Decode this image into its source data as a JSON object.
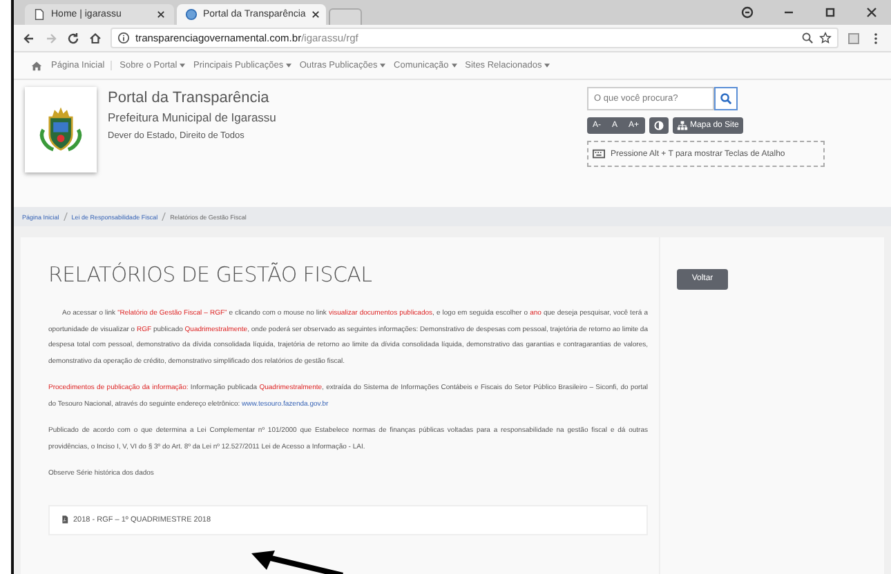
{
  "browser": {
    "tabs": [
      {
        "label": "Home | igarassu",
        "selected": false
      },
      {
        "label": "Portal da Transparência",
        "selected": true
      }
    ],
    "url": {
      "host": "transparenciagovernamental.com.br",
      "path": "/igarassu/rgf"
    }
  },
  "nav": {
    "home": "Página Inicial",
    "menus": [
      "Sobre o Portal",
      "Principais Publicações",
      "Outras Publicações",
      "Comunicação",
      "Sites Relacionados"
    ]
  },
  "header": {
    "title": "Portal da Transparência",
    "subtitle": "Prefeitura Municipal de Igarassu",
    "motto": "Dever do Estado, Direito de Todos",
    "search": {
      "placeholder": "O que você procura?"
    },
    "font_buttons": [
      "A-",
      "A",
      "A+"
    ],
    "sitemap": "Mapa do Site",
    "shortcut_hint": "Pressione Alt + T para mostrar Teclas de Atalho"
  },
  "breadcrumb": [
    {
      "label": "Página Inicial",
      "link": true
    },
    {
      "label": "Lei de Responsabilidade Fiscal",
      "link": true
    },
    {
      "label": "Relatórios de Gestão Fiscal",
      "link": false
    }
  ],
  "page": {
    "title": "RELATÓRIOS DE GESTÃO FISCAL",
    "back_button": "Voltar",
    "paragraphs": [
      {
        "indent": true,
        "parts": [
          {
            "kind": "text",
            "text": "Ao acessar o link "
          },
          {
            "kind": "highlight",
            "text": "“Relatório de Gestão Fiscal – RGF”"
          },
          {
            "kind": "text",
            "text": " e clicando com o mouse no link "
          },
          {
            "kind": "highlight",
            "text": "visualizar documentos publicados"
          },
          {
            "kind": "text",
            "text": ", e logo em seguida escolher o "
          },
          {
            "kind": "highlight",
            "text": "ano"
          },
          {
            "kind": "text",
            "text": " que deseja pesquisar, você terá a oportunidade de visualizar o "
          },
          {
            "kind": "highlight",
            "text": "RGF"
          },
          {
            "kind": "text",
            "text": " publicado "
          },
          {
            "kind": "highlight",
            "text": "Quadrimestralmente"
          },
          {
            "kind": "text",
            "text": ", onde poderá ser observado as seguintes informações: Demonstrativo de despesas com pessoal, trajetória de retorno ao limite da despesa total com pessoal, demonstrativo da dívida consolidada líquida, trajetória de retorno ao limite da dívida consolidada líquida, demonstrativo das garantias e contragarantias de valores, demonstrativo da operação de crédito, demonstrativo simplificado dos relatórios de gestão fiscal."
          }
        ]
      },
      {
        "indent": false,
        "parts": [
          {
            "kind": "highlight",
            "text": "Procedimentos de publicação da informação:"
          },
          {
            "kind": "text",
            "text": " Informação publicada "
          },
          {
            "kind": "highlight",
            "text": "Quadrimestralmente"
          },
          {
            "kind": "text",
            "text": ", extraída do Sistema de Informações Contábeis e Fiscais do Setor Público Brasileiro – Siconfi, do portal do Tesouro Nacional, através do seguinte endereço eletrônico: "
          },
          {
            "kind": "link",
            "text": "www.tesouro.fazenda.gov.br"
          }
        ]
      },
      {
        "indent": false,
        "parts": [
          {
            "kind": "text",
            "text": "Publicado de acordo com o que determina a Lei Complementar nº 101/2000 que Estabelece normas de finanças públicas voltadas para a responsabilidade na gestão fiscal e dá outras providências, o Inciso I, V, VI do § 3º do Art. 8º da Lei nº 12.527/2011 Lei de Acesso a Informação - LAI."
          }
        ]
      },
      {
        "indent": false,
        "parts": [
          {
            "kind": "text",
            "text": "Observe Série histórica dos dados"
          }
        ]
      }
    ],
    "documents": [
      "2018 - RGF – 1º QUADRIMESTRE 2018"
    ]
  }
}
